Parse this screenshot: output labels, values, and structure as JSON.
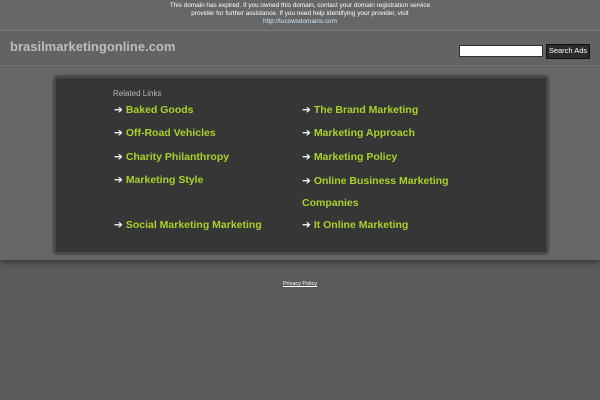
{
  "notice": {
    "text": "This domain has expired. If you owned this domain, contact your domain registration service provider for further assistance. If you need help identifying your provider, visit",
    "link": "http://tucowsdomains.com"
  },
  "header": {
    "domain": "brasilmarketingonline.com",
    "search_placeholder": "",
    "search_button": "Search Ads"
  },
  "related": {
    "title": "Related Links",
    "arrow": "➔",
    "left": [
      "Baked Goods",
      "Off-Road Vehicles",
      "Charity Philanthropy",
      "Marketing Style",
      "Social Marketing Marketing"
    ],
    "right": [
      "The Brand Marketing",
      "Marketing Approach",
      "Marketing Policy",
      "Online Business Marketing Companies",
      "It Online Marketing"
    ]
  },
  "footer": {
    "privacy": "Privacy Policy"
  },
  "colors": {
    "link": "#a9d12c",
    "background": "#5a5a5a",
    "panel": "#363636"
  }
}
